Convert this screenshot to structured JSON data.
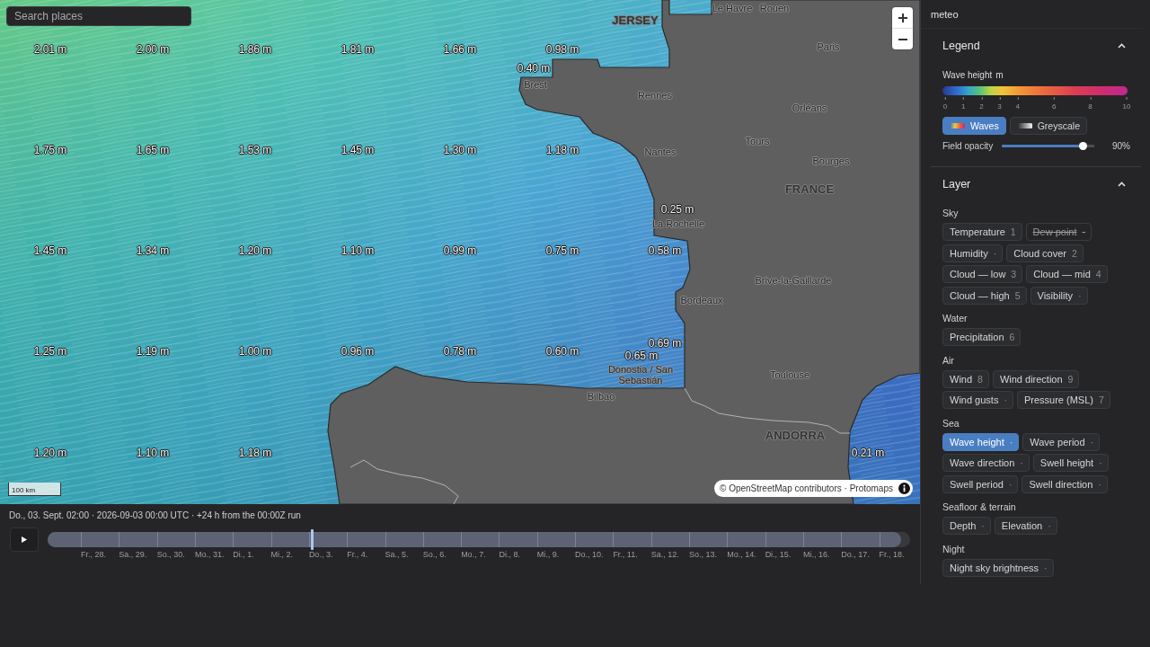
{
  "search": {
    "placeholder": "Search places"
  },
  "map": {
    "wave_labels": [
      "2.01 m",
      "2.00 m",
      "1.86 m",
      "1.81 m",
      "1.66 m",
      "0.98 m",
      "0.40 m",
      "1.75 m",
      "1.65 m",
      "1.53 m",
      "1.45 m",
      "1.30 m",
      "1.18 m",
      "0.25 m",
      "1.45 m",
      "1.34 m",
      "1.20 m",
      "1.10 m",
      "0.99 m",
      "0.75 m",
      "0.58 m",
      "0.69 m",
      "1.25 m",
      "1.19 m",
      "1.00 m",
      "0.96 m",
      "0.78 m",
      "0.60 m",
      "0.65 m",
      "1.20 m",
      "1.10 m",
      "1.18 m",
      "0.21 m"
    ],
    "place_labels": [
      {
        "text": "Le Havre",
        "kind": "city"
      },
      {
        "text": "Rouen",
        "kind": "city"
      },
      {
        "text": "JERSEY",
        "kind": "country"
      },
      {
        "text": "Paris",
        "kind": "city"
      },
      {
        "text": "Brest",
        "kind": "city"
      },
      {
        "text": "Rennes",
        "kind": "city"
      },
      {
        "text": "Orléans",
        "kind": "city"
      },
      {
        "text": "Tours",
        "kind": "city"
      },
      {
        "text": "Nantes",
        "kind": "city"
      },
      {
        "text": "Bourges",
        "kind": "city"
      },
      {
        "text": "FRANCE",
        "kind": "country"
      },
      {
        "text": "La Rochelle",
        "kind": "city"
      },
      {
        "text": "Brive-la-Gaillarde",
        "kind": "city"
      },
      {
        "text": "Bordeaux",
        "kind": "city"
      },
      {
        "text": "Donostia / San Sebastián",
        "kind": "city"
      },
      {
        "text": "Toulouse",
        "kind": "city"
      },
      {
        "text": "Bilbao",
        "kind": "city"
      },
      {
        "text": "ANDORRA",
        "kind": "country"
      }
    ],
    "scale": "100 km",
    "attribution": "© OpenStreetMap contributors · Protomaps"
  },
  "timeline": {
    "status": "Do., 03. Sept. 02:00 · 2026-09-03 00:00 UTC · +24 h from the 00:00Z run",
    "level": 0.306,
    "days": [
      "Fr., 28.",
      "Sa., 29.",
      "So., 30.",
      "Mo., 31.",
      "Di., 1.",
      "Mi., 2.",
      "Do., 3.",
      "Fr., 4.",
      "Sa., 5.",
      "So., 6.",
      "Mo., 7.",
      "Di., 8.",
      "Mi., 9.",
      "Do., 10.",
      "Fr., 11.",
      "Sa., 12.",
      "So., 13.",
      "Mo., 14.",
      "Di., 15.",
      "Mi., 16.",
      "Do., 17.",
      "Fr., 18."
    ]
  },
  "panel": {
    "title": "meteo",
    "legend": {
      "heading": "Legend",
      "expanded": true,
      "field": "Wave height",
      "unit": "m",
      "ticks": [
        "0",
        "1",
        "2",
        "3",
        "4",
        "6",
        "8",
        "10"
      ],
      "palettes": [
        {
          "label": "Waves",
          "kind": "color",
          "selected": true
        },
        {
          "label": "Greyscale",
          "kind": "grey",
          "selected": false
        }
      ],
      "opacity": {
        "label": "Field opacity",
        "level": 0.88,
        "reading": "90%"
      }
    },
    "layer": {
      "heading": "Layer",
      "expanded": true,
      "groups": [
        {
          "name": "Sky",
          "layers": [
            {
              "label": "Temperature",
              "key": "1",
              "selected": false,
              "disabled": false
            },
            {
              "label": "Dew point",
              "key": "·",
              "selected": false,
              "disabled": true
            },
            {
              "label": "Humidity",
              "key": "·",
              "selected": false,
              "disabled": false
            },
            {
              "label": "Cloud cover",
              "key": "2",
              "selected": false,
              "disabled": false
            },
            {
              "label": "Cloud — low",
              "key": "3",
              "selected": false,
              "disabled": false
            },
            {
              "label": "Cloud — mid",
              "key": "4",
              "selected": false,
              "disabled": false
            },
            {
              "label": "Cloud — high",
              "key": "5",
              "selected": false,
              "disabled": false
            },
            {
              "label": "Visibility",
              "key": "·",
              "selected": false,
              "disabled": false
            }
          ]
        },
        {
          "name": "Water",
          "layers": [
            {
              "label": "Precipitation",
              "key": "6",
              "selected": false,
              "disabled": false
            }
          ]
        },
        {
          "name": "Air",
          "layers": [
            {
              "label": "Wind",
              "key": "8",
              "selected": false,
              "disabled": false
            },
            {
              "label": "Wind direction",
              "key": "9",
              "selected": false,
              "disabled": false
            },
            {
              "label": "Wind gusts",
              "key": "·",
              "selected": false,
              "disabled": false
            },
            {
              "label": "Pressure (MSL)",
              "key": "7",
              "selected": false,
              "disabled": false
            }
          ]
        },
        {
          "name": "Sea",
          "layers": [
            {
              "label": "Wave height",
              "key": "·",
              "selected": true,
              "disabled": false
            },
            {
              "label": "Wave period",
              "key": "·",
              "selected": false,
              "disabled": false
            },
            {
              "label": "Wave direction",
              "key": "·",
              "selected": false,
              "disabled": false
            },
            {
              "label": "Swell height",
              "key": "·",
              "selected": false,
              "disabled": false
            },
            {
              "label": "Swell period",
              "key": "·",
              "selected": false,
              "disabled": false
            },
            {
              "label": "Swell direction",
              "key": "·",
              "selected": false,
              "disabled": false
            }
          ]
        },
        {
          "name": "Seafloor & terrain",
          "layers": [
            {
              "label": "Depth",
              "key": "·",
              "selected": false,
              "disabled": false
            },
            {
              "label": "Elevation",
              "key": "·",
              "selected": false,
              "disabled": false
            }
          ]
        },
        {
          "name": "Night",
          "layers": [
            {
              "label": "Night sky brightness",
              "key": "·",
              "selected": false,
              "disabled": false
            }
          ]
        }
      ]
    }
  }
}
